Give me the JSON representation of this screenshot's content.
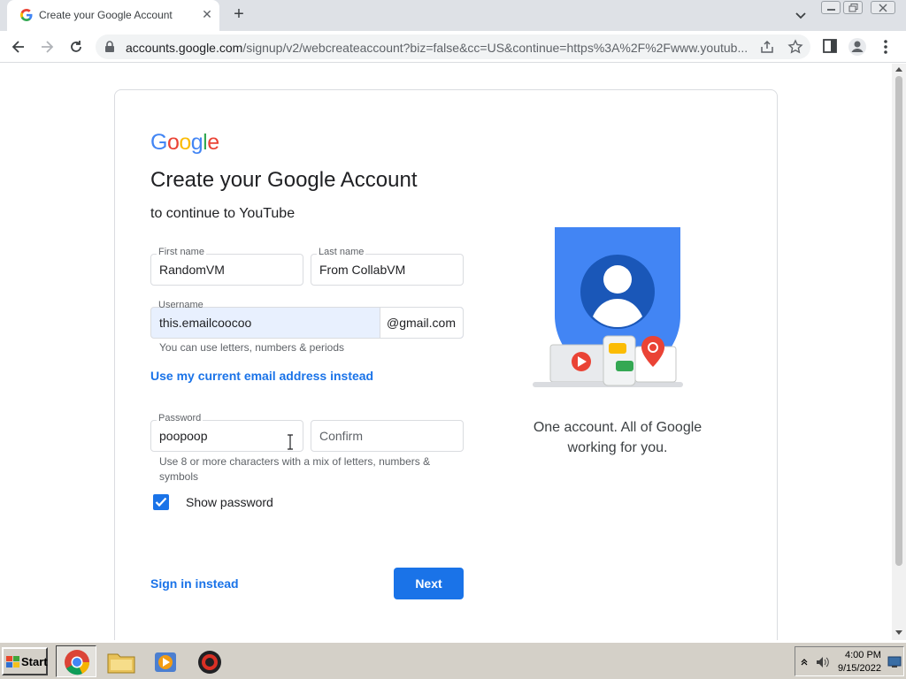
{
  "browser": {
    "tab_title": "Create your Google Account",
    "url_host": "accounts.google.com",
    "url_rest": "/signup/v2/webcreateaccount?biz=false&cc=US&continue=https%3A%2F%2Fwww.youtub..."
  },
  "page": {
    "logo": [
      "G",
      "o",
      "o",
      "g",
      "l",
      "e"
    ],
    "logo_colors": [
      "#4285F4",
      "#EA4335",
      "#FBBC05",
      "#4285F4",
      "#34A853",
      "#EA4335"
    ],
    "heading": "Create your Google Account",
    "subheading": "to continue to YouTube",
    "first_name": {
      "label": "First name",
      "value": "RandomVM"
    },
    "last_name": {
      "label": "Last name",
      "value": "From CollabVM"
    },
    "username": {
      "label": "Username",
      "value": "this.emailcoocoo",
      "suffix": "@gmail.com",
      "hint": "You can use letters, numbers & periods"
    },
    "use_email_link": "Use my current email address instead",
    "password": {
      "label": "Password",
      "value": "poopoop"
    },
    "confirm": {
      "placeholder": "Confirm"
    },
    "password_hint_line1": "Use 8 or more characters with a mix of letters, numbers &",
    "password_hint_line2": "symbols",
    "show_password": {
      "label": "Show password",
      "checked": true
    },
    "sign_in_link": "Sign in instead",
    "next_button": "Next",
    "tagline_line1": "One account. All of Google",
    "tagline_line2": "working for you."
  },
  "taskbar": {
    "start_label": "Start",
    "apps": [
      "chrome-icon",
      "folder-icon",
      "media-player-icon",
      "collabvm-icon"
    ],
    "clock_time": "4:00 PM",
    "clock_date": "9/15/2022"
  },
  "colors": {
    "accent": "#1a73e8",
    "shield": "#4285F4"
  }
}
